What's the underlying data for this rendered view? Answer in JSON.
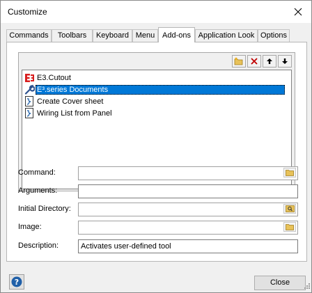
{
  "window": {
    "title": "Customize"
  },
  "tabs": [
    {
      "label": "Commands"
    },
    {
      "label": "Toolbars"
    },
    {
      "label": "Keyboard"
    },
    {
      "label": "Menu"
    },
    {
      "label": "Add-ons"
    },
    {
      "label": "Application Look"
    },
    {
      "label": "Options"
    }
  ],
  "active_tab": "Add-ons",
  "toolbar": {
    "icons": [
      "new-folder-icon",
      "delete-icon",
      "move-up-icon",
      "move-down-icon"
    ]
  },
  "tools": [
    {
      "label": "E3.Cutout",
      "icon": "e3-logo-icon",
      "selected": false
    },
    {
      "label": "E³.series Documents",
      "icon": "wrench-icon",
      "selected": true
    },
    {
      "label": "Create Cover sheet",
      "icon": "script-icon",
      "selected": false
    },
    {
      "label": "Wiring List from Panel",
      "icon": "script-icon",
      "selected": false
    }
  ],
  "form": {
    "command": {
      "label": "Command:",
      "value": ""
    },
    "arguments": {
      "label": "Arguments:",
      "value": ""
    },
    "initial_directory": {
      "label": "Initial Directory:",
      "value": ""
    },
    "image": {
      "label": "Image:",
      "value": ""
    },
    "description": {
      "label": "Description:",
      "value": "Activates user-defined tool"
    }
  },
  "buttons": {
    "close": "Close"
  },
  "colors": {
    "selection": "#0078d7",
    "background": "#f0f0f0"
  }
}
